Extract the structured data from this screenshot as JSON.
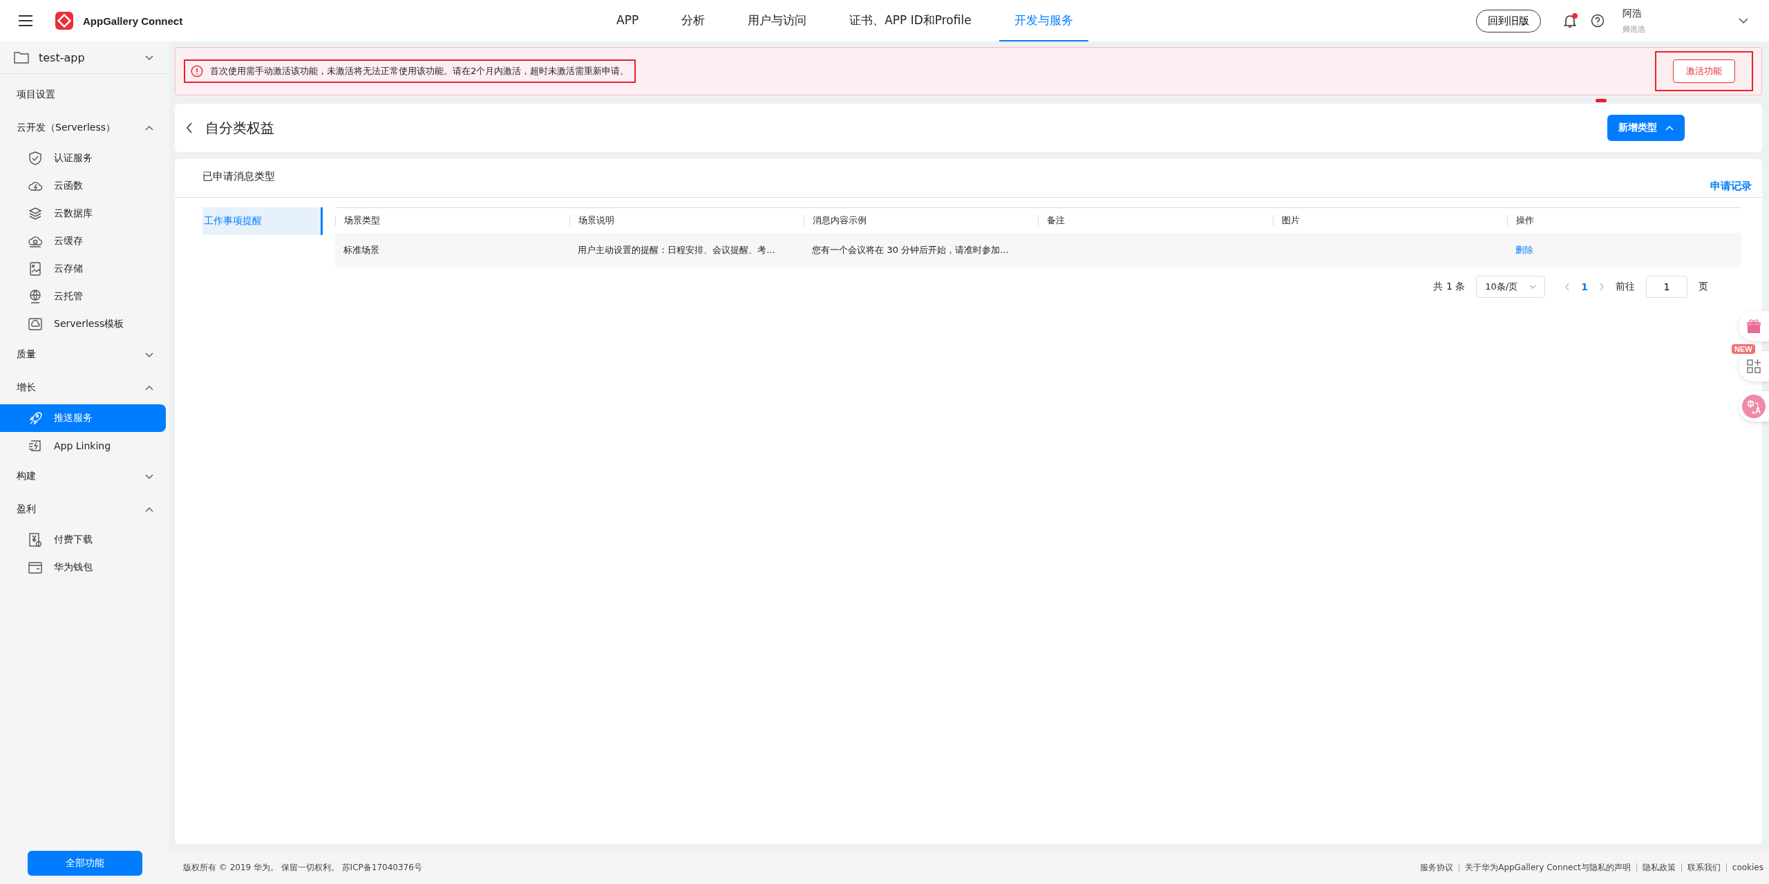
{
  "header": {
    "app_name": "AppGallery Connect",
    "nav": [
      {
        "label": "APP",
        "selected": false
      },
      {
        "label": "分析",
        "selected": false
      },
      {
        "label": "用户与访问",
        "selected": false
      },
      {
        "label": "证书、APP ID和Profile",
        "selected": false
      },
      {
        "label": "开发与服务",
        "selected": true
      }
    ],
    "old_version_button": "回到旧版",
    "has_unread": true,
    "user": {
      "name": "阿浩",
      "subtitle": "师浩浩"
    }
  },
  "sidebar": {
    "project": "test-app",
    "items": [
      {
        "kind": "link",
        "label": "项目设置"
      },
      {
        "kind": "group",
        "label": "云开发（Serverless）",
        "expanded": true,
        "children": [
          {
            "label": "认证服务",
            "selected": false
          },
          {
            "label": "云函数",
            "selected": false
          },
          {
            "label": "云数据库",
            "selected": false
          },
          {
            "label": "云缓存",
            "selected": false
          },
          {
            "label": "云存储",
            "selected": false
          },
          {
            "label": "云托管",
            "selected": false
          },
          {
            "label": "Serverless模板",
            "selected": false
          }
        ]
      },
      {
        "kind": "group",
        "label": "质量",
        "expanded": false
      },
      {
        "kind": "group",
        "label": "增长",
        "expanded": true,
        "children": [
          {
            "label": "推送服务",
            "selected": true
          },
          {
            "label": "App Linking",
            "selected": false
          }
        ]
      },
      {
        "kind": "group",
        "label": "构建",
        "expanded": false
      },
      {
        "kind": "group",
        "label": "盈利",
        "expanded": true,
        "children": [
          {
            "label": "付费下载",
            "selected": false
          },
          {
            "label": "华为钱包",
            "selected": false
          }
        ]
      }
    ],
    "all_features_button": "全部功能"
  },
  "alert": {
    "message": "首次使用需手动激活该功能，未激活将无法正常使用该功能。请在2个月内激活，超时未激活需重新申请。",
    "button": "激活功能",
    "highlighted": true
  },
  "page_header": {
    "title": "自分类权益",
    "add_button": "新增类型"
  },
  "card": {
    "title": "已申请消息类型",
    "record_link": "申请记录",
    "categories": [
      {
        "label": "工作事项提醒",
        "selected": true
      }
    ],
    "table": {
      "columns": [
        "场景类型",
        "场景说明",
        "消息内容示例",
        "备注",
        "图片",
        "操作"
      ],
      "rows": [
        {
          "scene": "标准场景",
          "description": "用户主动设置的提醒：日程安排、会议提醒、考...",
          "example": "您有一个会议将在 30 分钟后开始，请准时参加...",
          "action": "删除"
        }
      ]
    },
    "pagination": {
      "total": "共 1 条",
      "page_size": "10条/页",
      "pages": [
        {
          "label": "1",
          "selected": true
        }
      ],
      "goto_label": "前往",
      "goto_value": "1",
      "page_unit": "页"
    }
  },
  "floating": {
    "new_badge": "NEW"
  },
  "footer": {
    "copyright": "版权所有 © 2019 华为。 保留一切权利。 苏ICP备17040376号",
    "links": [
      "服务协议",
      "关于华为AppGallery Connect与隐私的声明",
      "隐私政策",
      "联系我们",
      "cookies"
    ]
  }
}
